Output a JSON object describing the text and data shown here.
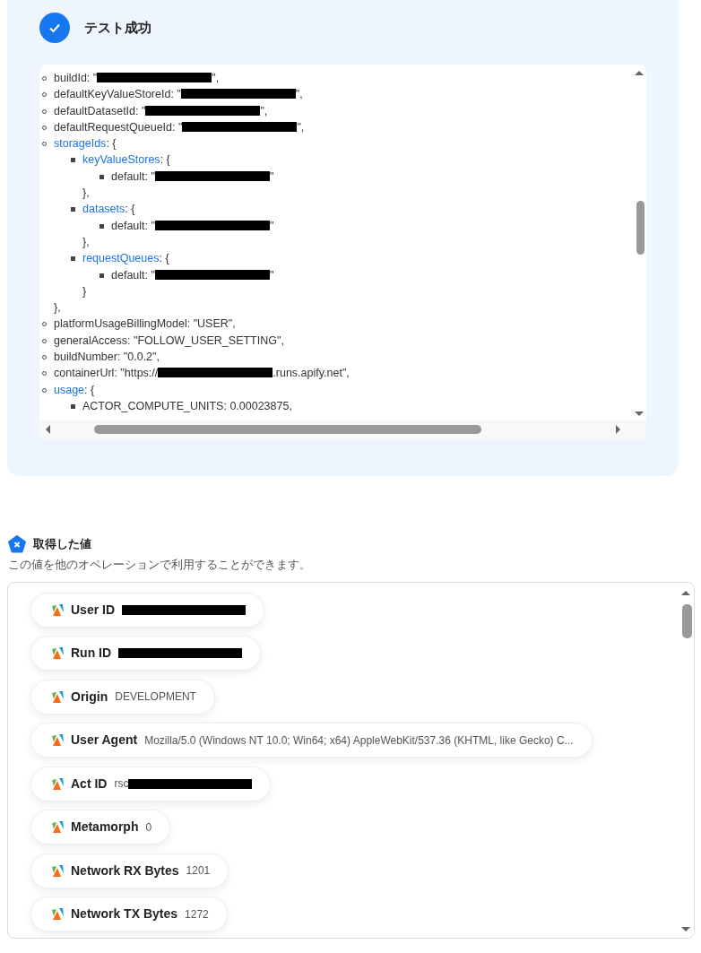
{
  "result": {
    "title": "テスト成功",
    "lines": [
      {
        "key": "buildId",
        "link": false,
        "before": ": \"",
        "redacted": true,
        "after": "\","
      },
      {
        "key": "defaultKeyValueStoreId",
        "link": false,
        "before": ": \"",
        "redacted": true,
        "after": "\","
      },
      {
        "key": "defaultDatasetId",
        "link": false,
        "before": ": \"",
        "redacted": true,
        "after": "\","
      },
      {
        "key": "defaultRequestQueueId",
        "link": false,
        "before": ": \"",
        "redacted": true,
        "after": "\","
      },
      {
        "key": "storageIds",
        "link": true,
        "before": ": {",
        "closing": "},",
        "children": [
          {
            "key": "keyValueStores",
            "link": true,
            "before": ": {",
            "closing": "},",
            "children": [
              {
                "key": "default",
                "link": false,
                "before": ": \"",
                "redacted": true,
                "after": "\""
              }
            ]
          },
          {
            "key": "datasets",
            "link": true,
            "before": ": {",
            "closing": "},",
            "children": [
              {
                "key": "default",
                "link": false,
                "before": ": \"",
                "redacted": true,
                "after": "\""
              }
            ]
          },
          {
            "key": "requestQueues",
            "link": true,
            "before": ": {",
            "closing": "}",
            "children": [
              {
                "key": "default",
                "link": false,
                "before": ": \"",
                "redacted": true,
                "after": "\""
              }
            ]
          }
        ]
      },
      {
        "key": "platformUsageBillingModel",
        "link": false,
        "before": ": \"USER\","
      },
      {
        "key": "generalAccess",
        "link": false,
        "before": ": \"FOLLOW_USER_SETTING\","
      },
      {
        "key": "buildNumber",
        "link": false,
        "before": ": \"0.0.2\","
      },
      {
        "key": "containerUrl",
        "link": false,
        "before": ": \"https://",
        "redacted": true,
        "after": ".runs.apify.net\","
      },
      {
        "key": "usage",
        "link": true,
        "before": ": {",
        "children": [
          {
            "key": "ACTOR_COMPUTE_UNITS",
            "link": false,
            "before": ": 0.00023875,"
          }
        ]
      }
    ]
  },
  "values": {
    "title": "取得した値",
    "description": "この値を他のオペレーションで利用することができます。",
    "items": [
      {
        "label": "User ID",
        "redacted": true
      },
      {
        "label": "Run ID",
        "redacted": true
      },
      {
        "label": "Origin",
        "value": "DEVELOPMENT"
      },
      {
        "label": "User Agent",
        "value": "Mozilla/5.0 (Windows NT 10.0; Win64; x64) AppleWebKit/537.36 (KHTML, like Gecko) C..."
      },
      {
        "label": "Act ID",
        "value": "rsc",
        "redacted": true
      },
      {
        "label": "Metamorph",
        "value": "0"
      },
      {
        "label": "Network RX Bytes",
        "value": "1201"
      },
      {
        "label": "Network TX Bytes",
        "value": "1272"
      }
    ]
  }
}
